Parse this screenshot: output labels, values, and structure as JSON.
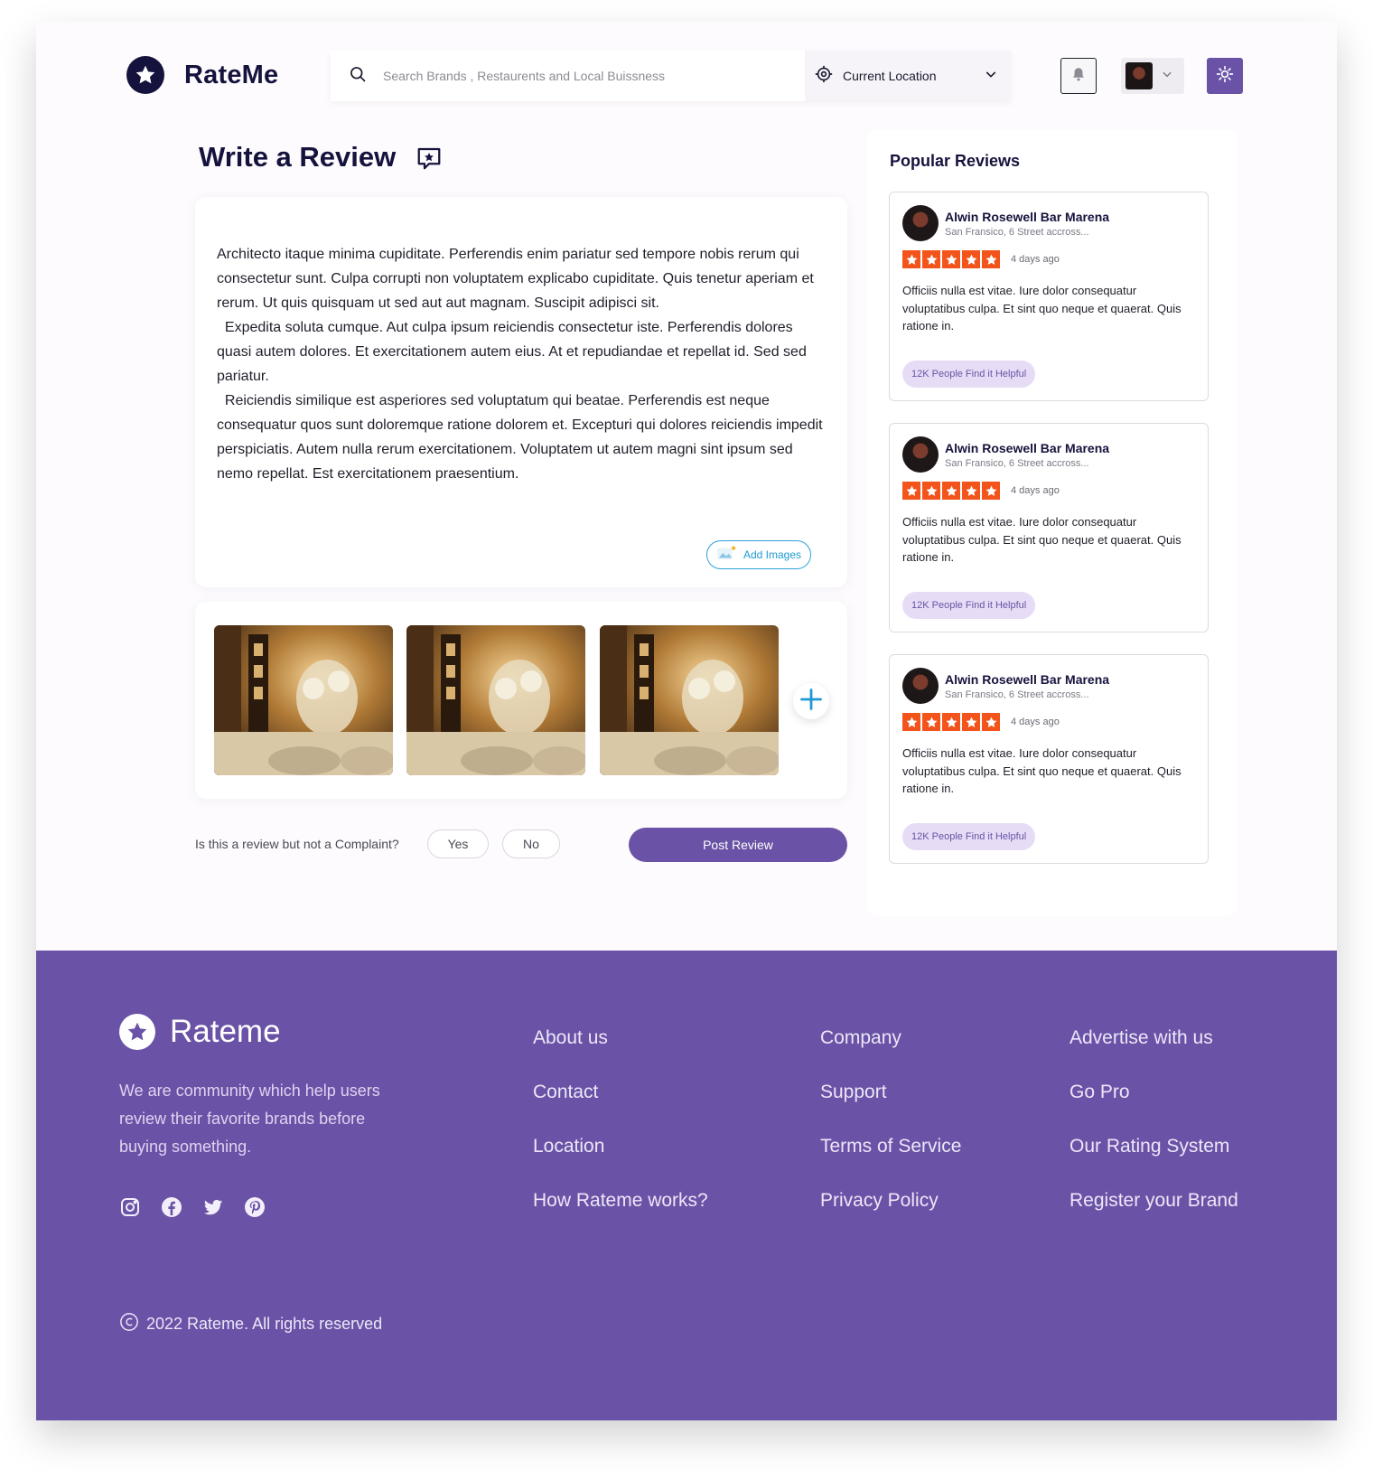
{
  "app": {
    "logo_text": "RateMe",
    "accent_color": "#6a52a6",
    "star_color": "#f2541b"
  },
  "header": {
    "search_placeholder": "Search Brands , Restaurents and Local Buissness",
    "location_label": "Current Location",
    "icons": [
      "search-icon",
      "location-target-icon",
      "chevron-down-icon",
      "bell-icon",
      "sun-icon"
    ]
  },
  "main": {
    "title": "Write a Review",
    "review_text": "Architecto itaque minima cupiditate. Perferendis enim pariatur sed tempore nobis rerum qui consectetur sunt. Culpa corrupti non voluptatem explicabo cupiditate. Quis tenetur aperiam et rerum. Ut quis quisquam ut sed aut aut magnam. Suscipit adipisci sit.\n  Expedita soluta cumque. Aut culpa ipsum reiciendis consectetur iste. Perferendis dolores quasi autem dolores. Et exercitationem autem eius. At et repudiandae et repellat id. Sed sed pariatur.\n  Reiciendis similique est asperiores sed voluptatum qui beatae. Perferendis est neque consequatur quos sunt doloremque ratione dolorem et. Excepturi qui dolores reiciendis impedit perspiciatis. Autem nulla rerum exercitationem. Voluptatem ut autem magni sint ipsum sed nemo repellat. Est exercitationem praesentium.",
    "add_images_label": "Add Images",
    "complaint_question": "Is this a review but not a Complaint?",
    "yes_label": "Yes",
    "no_label": "No",
    "post_label": "Post Review"
  },
  "sidebar": {
    "title": "Popular Reviews",
    "reviews": [
      {
        "name": "Alwin Rosewell Bar Marena",
        "location": "San Fransico, 6 Street accross...",
        "rating": 5,
        "time": "4 days ago",
        "text": "Officiis nulla est vitae. Iure dolor consequatur voluptatibus culpa. Et sint quo neque et quaerat. Quis ratione in.",
        "helpful": "12K People Find it Helpful"
      },
      {
        "name": "Alwin Rosewell Bar Marena",
        "location": "San Fransico, 6 Street accross...",
        "rating": 5,
        "time": "4 days ago",
        "text": "Officiis nulla est vitae. Iure dolor consequatur voluptatibus culpa. Et sint quo neque et quaerat. Quis ratione in.",
        "helpful": "12K People Find it Helpful"
      },
      {
        "name": "Alwin Rosewell Bar Marena",
        "location": "San Fransico, 6 Street accross...",
        "rating": 5,
        "time": "4 days ago",
        "text": "Officiis nulla est vitae. Iure dolor consequatur voluptatibus culpa. Et sint quo neque et quaerat. Quis ratione in.",
        "helpful": "12K People Find it Helpful"
      }
    ]
  },
  "footer": {
    "logo_text": "Rateme",
    "description": "We are community which help users review their favorite brands before buying something.",
    "columns": [
      [
        "About us",
        "Contact",
        "Location",
        "How Rateme works?"
      ],
      [
        "Company",
        "Support",
        "Terms of Service",
        "Privacy Policy"
      ],
      [
        "Advertise with us",
        "Go Pro",
        "Our Rating System",
        "Register your Brand"
      ]
    ],
    "social_icons": [
      "instagram-icon",
      "facebook-icon",
      "twitter-icon",
      "pinterest-icon"
    ],
    "copyright": "2022  Rateme. All  rights reserved"
  }
}
